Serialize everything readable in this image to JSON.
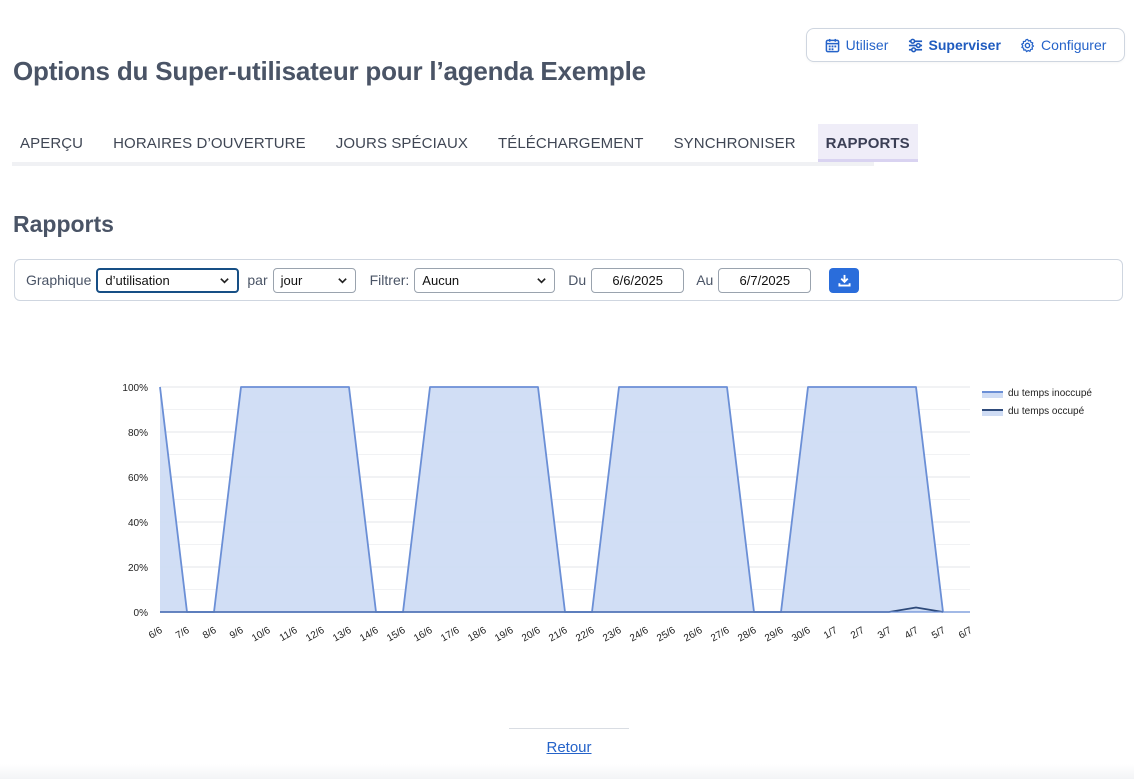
{
  "colors": {
    "accent": "#2563c9",
    "area_fill": "#cfdcf4",
    "area_line": "#6b8fd6",
    "occupied_line": "#2e4a7a"
  },
  "topnav": [
    {
      "label": "Utiliser",
      "icon": "calendar-icon",
      "active": false
    },
    {
      "label": "Superviser",
      "icon": "sliders-icon",
      "active": true
    },
    {
      "label": "Configurer",
      "icon": "gear-icon",
      "active": false
    }
  ],
  "page": {
    "title": "Options du Super-utilisateur pour l’agenda Exemple"
  },
  "tabs": [
    {
      "label": "APERÇU",
      "active": false
    },
    {
      "label": "HORAIRES D’OUVERTURE",
      "active": false
    },
    {
      "label": "JOURS SPÉCIAUX",
      "active": false
    },
    {
      "label": "TÉLÉCHARGEMENT",
      "active": false
    },
    {
      "label": "SYNCHRONISER",
      "active": false
    },
    {
      "label": "RAPPORTS",
      "active": true
    }
  ],
  "section": {
    "title": "Rapports"
  },
  "filters": {
    "graph_label": "Graphique",
    "graph_value": "d’utilisation",
    "per_label": "par",
    "per_value": "jour",
    "filter_label": "Filtrer:",
    "filter_value": "Aucun",
    "from_label": "Du",
    "from_value": "6/6/2025",
    "to_label": "Au",
    "to_value": "6/7/2025",
    "download_icon": "download-icon"
  },
  "chart_data": {
    "type": "area",
    "x": [
      "6/6",
      "7/6",
      "8/6",
      "9/6",
      "10/6",
      "11/6",
      "12/6",
      "13/6",
      "14/6",
      "15/6",
      "16/6",
      "17/6",
      "18/6",
      "19/6",
      "20/6",
      "21/6",
      "22/6",
      "23/6",
      "24/6",
      "25/6",
      "26/6",
      "27/6",
      "28/6",
      "29/6",
      "30/6",
      "1/7",
      "2/7",
      "3/7",
      "4/7",
      "5/7",
      "6/7"
    ],
    "series": [
      {
        "name": "du temps inoccupé",
        "values": [
          100,
          0,
          0,
          100,
          100,
          100,
          100,
          100,
          0,
          0,
          100,
          100,
          100,
          100,
          100,
          0,
          0,
          100,
          100,
          100,
          100,
          100,
          0,
          0,
          100,
          100,
          100,
          100,
          100,
          0,
          null
        ]
      },
      {
        "name": "du temps occupé",
        "values": [
          0,
          0,
          0,
          0,
          0,
          0,
          0,
          0,
          0,
          0,
          0,
          0,
          0,
          0,
          0,
          0,
          0,
          0,
          0,
          0,
          0,
          0,
          0,
          0,
          0,
          0,
          0,
          0,
          2,
          0,
          null
        ]
      }
    ],
    "yticks": [
      "0%",
      "20%",
      "40%",
      "60%",
      "80%",
      "100%"
    ],
    "ylim": [
      0,
      100
    ],
    "grid": true,
    "legend_position": "top-right"
  },
  "footer": {
    "back_label": "Retour"
  }
}
